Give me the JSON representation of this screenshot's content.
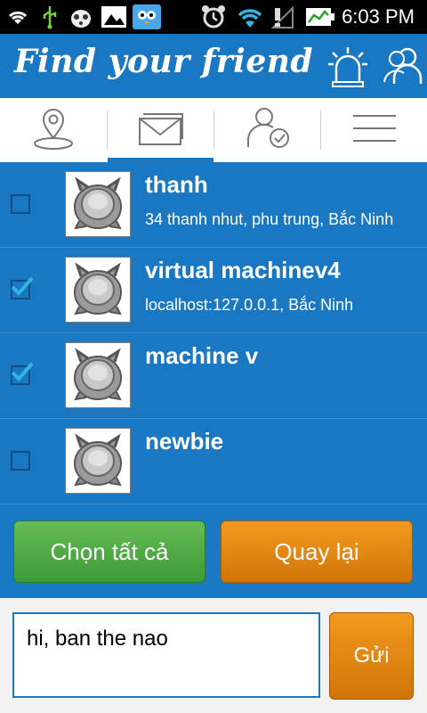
{
  "status_bar": {
    "time": "6:03 PM",
    "icons": [
      "wifi-icon",
      "usb-icon",
      "bug-icon",
      "image-icon",
      "bird-app-icon",
      "alarm-icon",
      "wifi-signal-icon",
      "no-signal-icon",
      "battery-icon"
    ]
  },
  "app_bar": {
    "title": "Find your friend",
    "actions": [
      "siren-icon",
      "people-icon"
    ]
  },
  "tabs": [
    {
      "name": "location",
      "icon": "location-pin-icon",
      "active": false
    },
    {
      "name": "messages",
      "icon": "envelope-icon",
      "active": true
    },
    {
      "name": "friend-check",
      "icon": "user-check-icon",
      "active": false
    },
    {
      "name": "menu",
      "icon": "menu-icon",
      "active": false
    }
  ],
  "friends": [
    {
      "name": "thanh",
      "address": "34 thanh nhut, phu trung, Bắc Ninh",
      "checked": false
    },
    {
      "name": "virtual machinev4",
      "address": "localhost:127.0.0.1, Bắc Ninh",
      "checked": true
    },
    {
      "name": "machine v",
      "address": "",
      "checked": true
    },
    {
      "name": "newbie",
      "address": "",
      "checked": false
    }
  ],
  "buttons": {
    "select_all": "Chọn tất cả",
    "back": "Quay lại",
    "send": "Gửi"
  },
  "composer": {
    "message_value": "hi, ban the nao"
  },
  "colors": {
    "primary": "#1a78c2",
    "green": "#4cab44",
    "orange": "#e58712",
    "check": "#33b5e5"
  }
}
